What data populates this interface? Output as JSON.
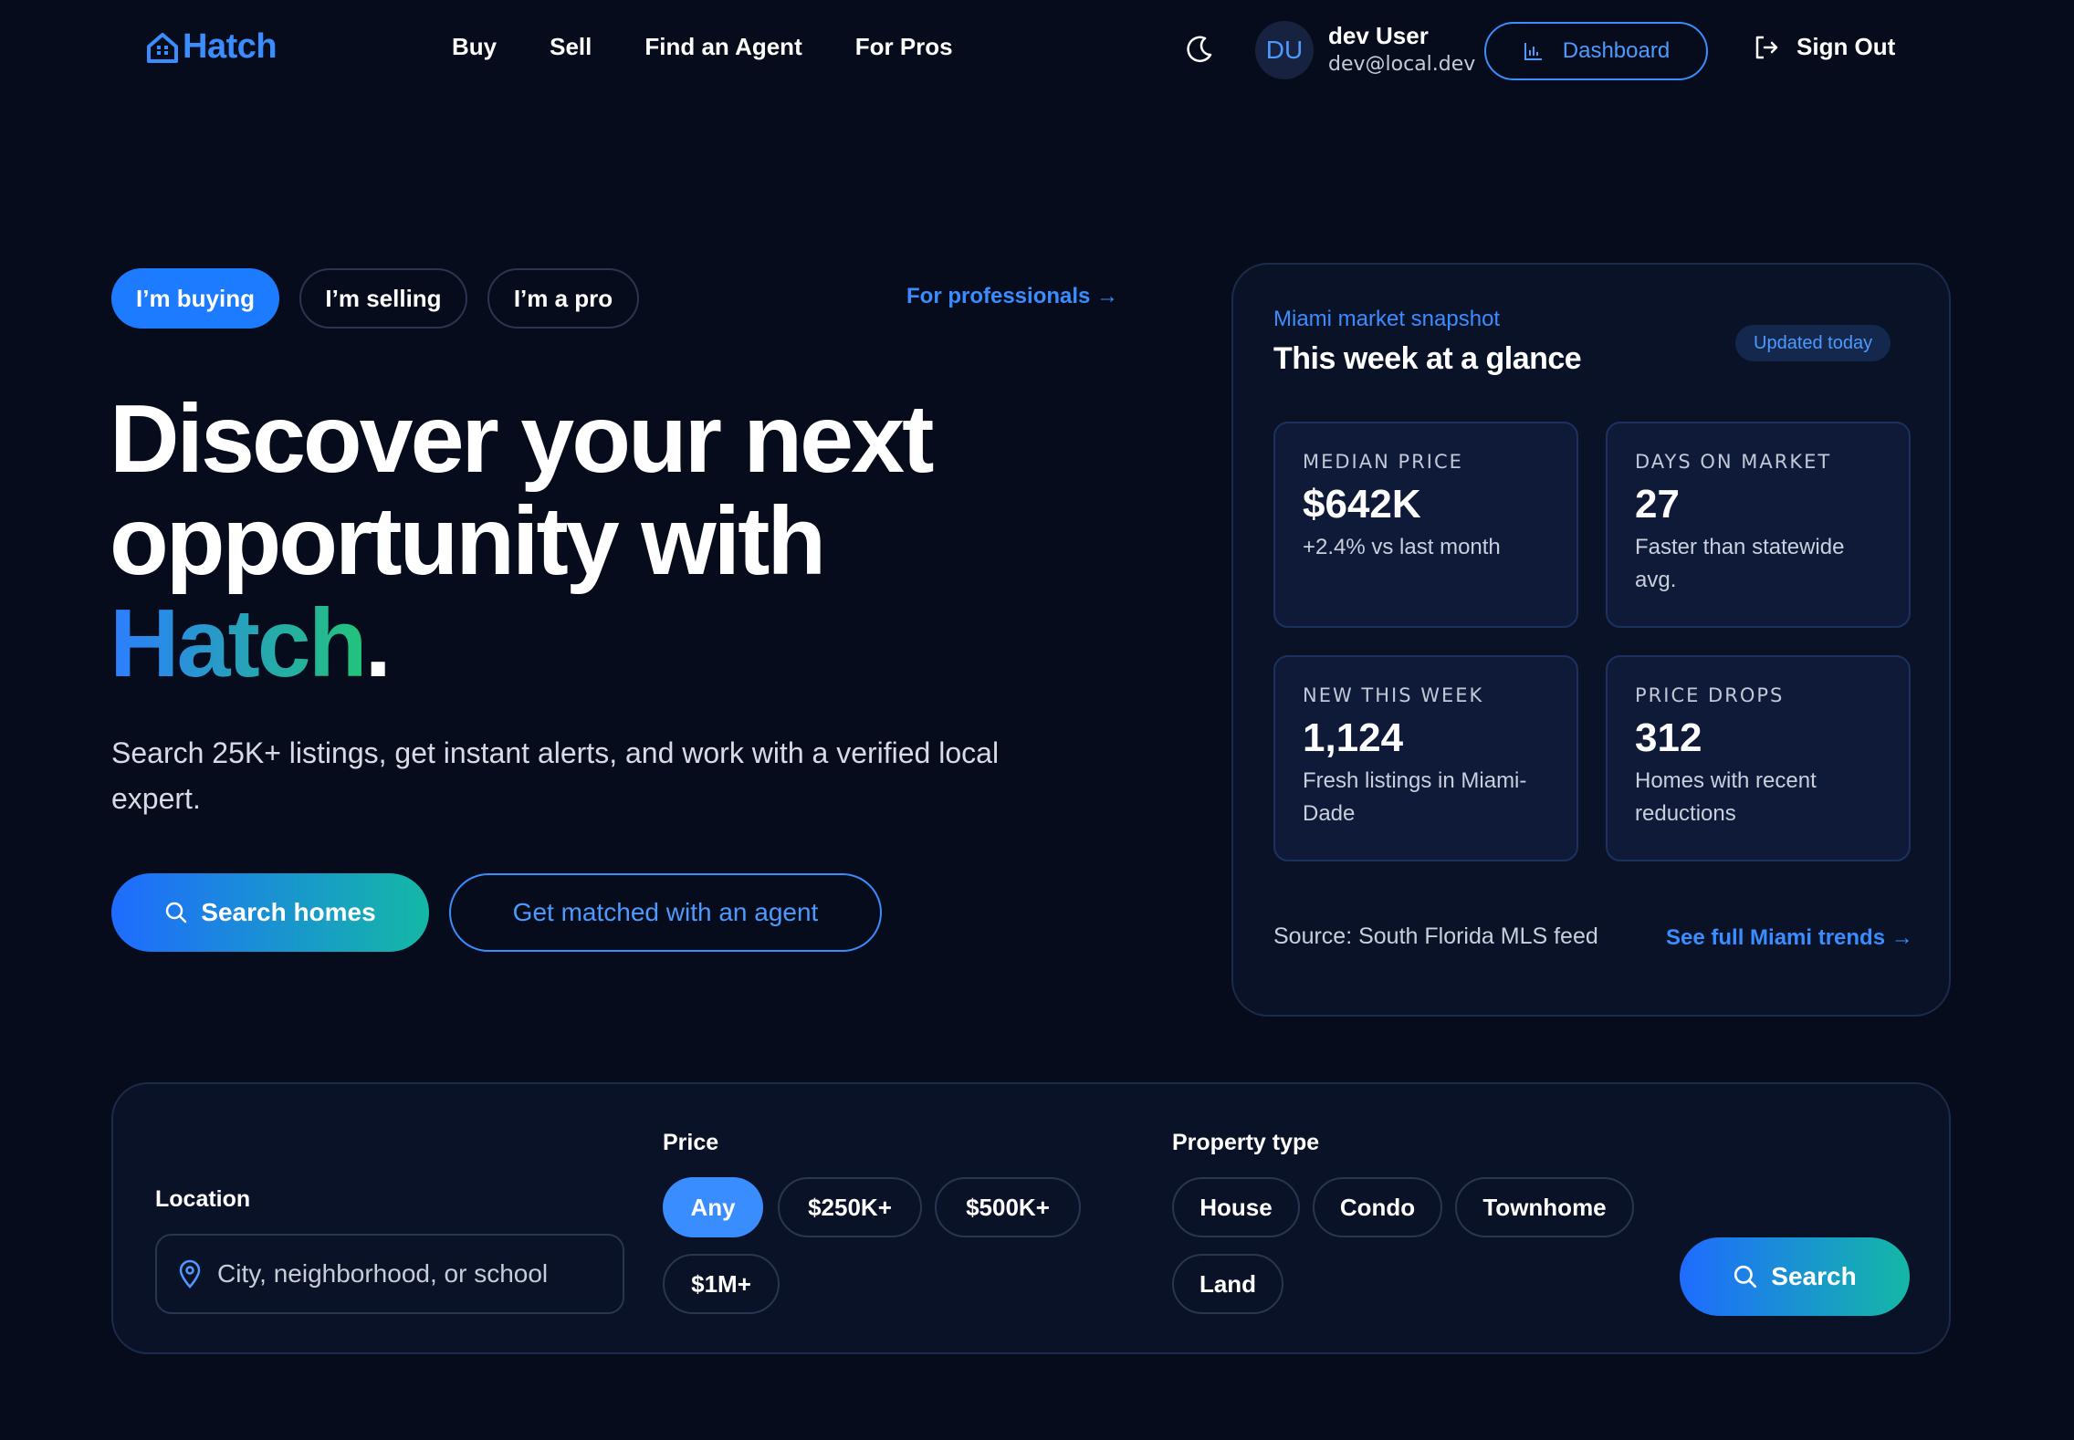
{
  "nav": {
    "logo_text": "Hatch",
    "links": [
      "Buy",
      "Sell",
      "Find an Agent",
      "For Pros"
    ],
    "theme_icon": "moon-icon",
    "user": {
      "initials": "DU",
      "name": "dev User",
      "email": "dev@local.dev"
    },
    "dashboard_label": "Dashboard",
    "signout_label": "Sign Out"
  },
  "hero": {
    "modes": [
      "I’m buying",
      "I’m selling",
      "I’m a pro"
    ],
    "active_mode": "I’m buying",
    "pro_link": "For professionals →",
    "headline_line1": "Discover your next",
    "headline_line2": "opportunity with",
    "headline_brand": "Hatch",
    "headline_end": ".",
    "subcopy": "Search 25K+ listings, get instant alerts, and work with a verified local expert.",
    "primary_cta": "Search homes",
    "secondary_cta": "Get matched with an agent"
  },
  "snapshot": {
    "kicker": "Miami market snapshot",
    "title": "This week at a glance",
    "badge": "Updated today",
    "stats": [
      {
        "label": "MEDIAN PRICE",
        "value": "$642K",
        "note": "+2.4% vs last month"
      },
      {
        "label": "DAYS ON MARKET",
        "value": "27",
        "note": "Faster than statewide avg."
      },
      {
        "label": "NEW THIS WEEK",
        "value": "1,124",
        "note": "Fresh listings in Miami-Dade"
      },
      {
        "label": "PRICE DROPS",
        "value": "312",
        "note": "Homes with recent reductions"
      }
    ],
    "source": "Source: South Florida MLS feed",
    "trends_link": "See full Miami trends →"
  },
  "search": {
    "location_label": "Location",
    "location_placeholder": "City, neighborhood, or school",
    "price_label": "Price",
    "price_options": [
      "Any",
      "$250K+",
      "$500K+",
      "$1M+"
    ],
    "price_selected": "Any",
    "type_label": "Property type",
    "type_options": [
      "House",
      "Condo",
      "Townhome",
      "Land"
    ],
    "button_label": "Search"
  },
  "colors": {
    "background": "#070c1c",
    "accent": "#3a8dff",
    "gradient_start": "#1f6bff",
    "gradient_end": "#14b8a6"
  }
}
